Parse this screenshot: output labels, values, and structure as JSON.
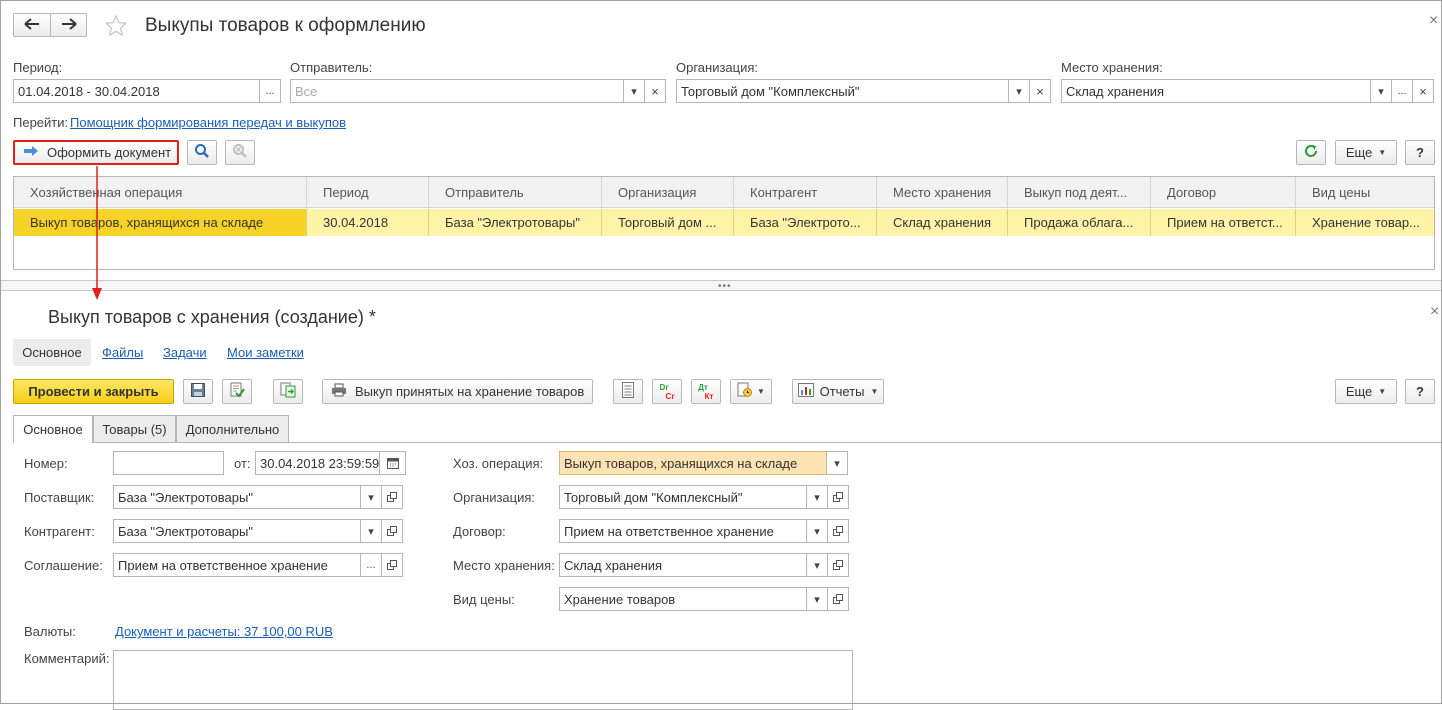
{
  "window": {
    "title": "Выкупы товаров к оформлению",
    "close_glyph": "×"
  },
  "filters": {
    "period_label": "Период:",
    "period_value": "01.04.2018 - 30.04.2018",
    "sender_label": "Отправитель:",
    "sender_placeholder": "Все",
    "org_label": "Организация:",
    "org_value": "Торговый дом \"Комплексный\"",
    "storage_label": "Место хранения:",
    "storage_value": "Склад хранения"
  },
  "goto": {
    "label": "Перейти:",
    "link": "Помощник формирования передач и выкупов"
  },
  "toolbar": {
    "make_doc": "Оформить документ",
    "more": "Еще",
    "help": "?"
  },
  "grid": {
    "columns": [
      "Хозяйственная операция",
      "Период",
      "Отправитель",
      "Организация",
      "Контрагент",
      "Место хранения",
      "Выкуп под деят...",
      "Договор",
      "Вид цены"
    ],
    "rows": [
      [
        "Выкуп товаров, хранящихся на складе",
        "30.04.2018",
        "База \"Электротовары\"",
        "Торговый дом ...",
        "База \"Электрото...",
        "Склад хранения",
        "Продажа облага...",
        "Прием на ответст...",
        "Хранение товар..."
      ]
    ]
  },
  "doc": {
    "title": "Выкуп товаров с хранения (создание) *",
    "nav": [
      "Основное",
      "Файлы",
      "Задачи",
      "Мои заметки"
    ],
    "post_close": "Провести и закрыть",
    "print_label": "Выкуп принятых на хранение товаров",
    "reports": "Отчеты",
    "more": "Еще",
    "help": "?",
    "dr_top": "Dr",
    "dr_bot": "Cr",
    "dt_top": "Дт",
    "dt_bot": "Кт",
    "tabs": [
      "Основное",
      "Товары (5)",
      "Дополнительно"
    ]
  },
  "form": {
    "number_label": "Номер:",
    "from_label": "от:",
    "date_value": "30.04.2018 23:59:59",
    "supplier_label": "Поставщик:",
    "supplier_value": "База \"Электротовары\"",
    "counterparty_label": "Контрагент:",
    "counterparty_value": "База \"Электротовары\"",
    "agreement_label": "Соглашение:",
    "agreement_value": "Прием на ответственное хранение",
    "operation_label": "Хоз. операция:",
    "operation_value": "Выкуп товаров, хранящихся на складе",
    "org_label": "Организация:",
    "org_value": "Торговый дом \"Комплексный\"",
    "contract_label": "Договор:",
    "contract_value": "Прием на ответственное хранение",
    "storage_label": "Место хранения:",
    "storage_value": "Склад хранения",
    "price_label": "Вид цены:",
    "price_value": "Хранение товаров",
    "currency_label": "Валюты:",
    "currency_link": "Документ и расчеты: 37 100,00 RUB",
    "comment_label": "Комментарий:"
  },
  "colors": {
    "accent_yellow": "#f7d327",
    "highlight_row": "#fff3a8",
    "link": "#1a5fb4",
    "annotation_red": "#e0201b"
  }
}
